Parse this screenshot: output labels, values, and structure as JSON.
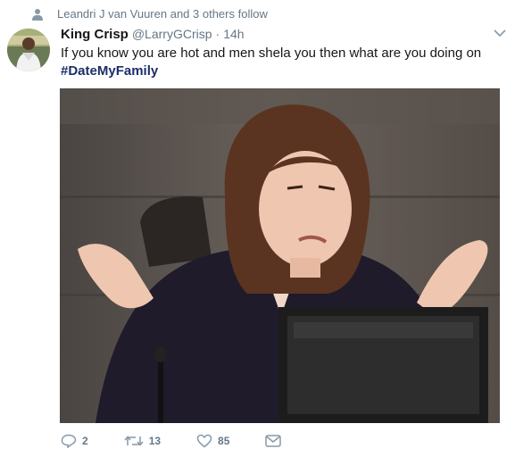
{
  "social_context": {
    "text": "Leandri J van Vuuren and 3 others follow"
  },
  "tweet": {
    "fullname": "King Crisp",
    "username": "@LarryGCrisp",
    "separator": "·",
    "time": "14h",
    "text": "If you know you are hot and men shela you then what are you doing on",
    "hashtag": "#DateMyFamily"
  },
  "actions": {
    "reply_count": "2",
    "retweet_count": "13",
    "like_count": "85"
  },
  "colors": {
    "muted": "#657786",
    "text": "#14171a",
    "hashtag": "#1c2e69"
  },
  "icons": [
    "person-icon",
    "caret-down-icon",
    "reply-icon",
    "retweet-icon",
    "like-icon",
    "message-icon"
  ]
}
